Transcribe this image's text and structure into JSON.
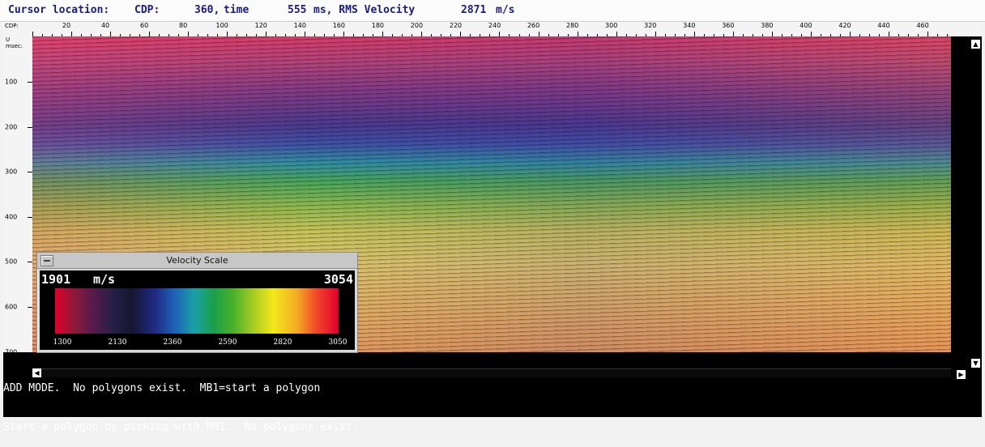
{
  "status": {
    "prefix": "Cursor location:",
    "cdp_label": "CDP:",
    "cdp_value": "360,",
    "time_label": "time",
    "time_value": "555",
    "time_unit": "ms, RMS Velocity",
    "velocity_value": "2871",
    "velocity_unit": "m/s"
  },
  "cdp_axis": {
    "name": "CDP:",
    "ticks": [
      "20",
      "40",
      "60",
      "80",
      "100",
      "120",
      "140",
      "160",
      "180",
      "200",
      "220",
      "240",
      "260",
      "280",
      "300",
      "320",
      "340",
      "360",
      "380",
      "400",
      "420",
      "440",
      "460"
    ]
  },
  "time_axis": {
    "name_line1": "U",
    "name_line2": "msec:",
    "ticks": [
      "100",
      "200",
      "300",
      "400",
      "500",
      "600",
      "700"
    ]
  },
  "velocity_scale": {
    "title": "Velocity Scale",
    "min_label": "1901",
    "unit": "m/s",
    "max_label": "3054",
    "tick_labels": [
      "1300",
      "2130",
      "2360",
      "2590",
      "2820",
      "3050"
    ]
  },
  "messages": [
    "ADD MODE.  No polygons exist.  MB1=start a polygon",
    "Start a polygon by picking with MB1.  No polygons exist."
  ],
  "colors": {
    "status_text": "#1a1a8c",
    "message_text": "#ffffff"
  },
  "icons": {
    "scroll_up": "triangle-up-icon",
    "scroll_down": "triangle-down-icon",
    "scroll_left": "triangle-left-icon",
    "scroll_right": "triangle-right-icon"
  }
}
